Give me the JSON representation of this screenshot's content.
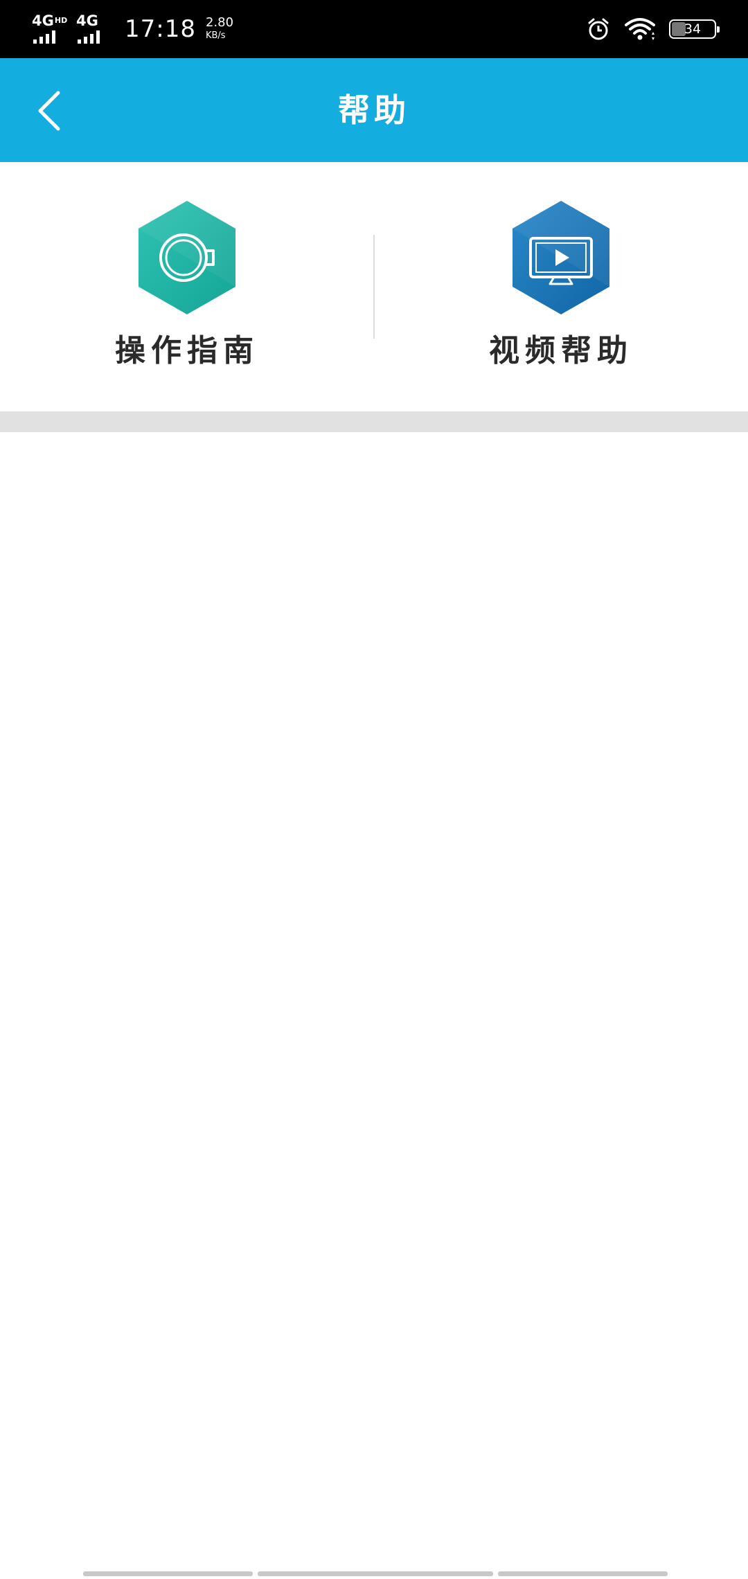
{
  "status_bar": {
    "network_1": "4G",
    "network_1_badge": "HD",
    "network_2": "4G",
    "time": "17:18",
    "speed_value": "2.80",
    "speed_unit": "KB/s",
    "battery_level": "34",
    "icons": [
      "alarm-icon",
      "wifi-icon",
      "battery-icon"
    ]
  },
  "app_bar": {
    "title": "帮助",
    "back_icon": "chevron-left-icon",
    "background_color": "#14ade0"
  },
  "help_menu": {
    "items": [
      {
        "label": "操作指南",
        "icon": "coffee-cup-icon",
        "color": "#1fb8a8"
      },
      {
        "label": "视频帮助",
        "icon": "tv-play-icon",
        "color": "#1a78b8"
      }
    ]
  }
}
